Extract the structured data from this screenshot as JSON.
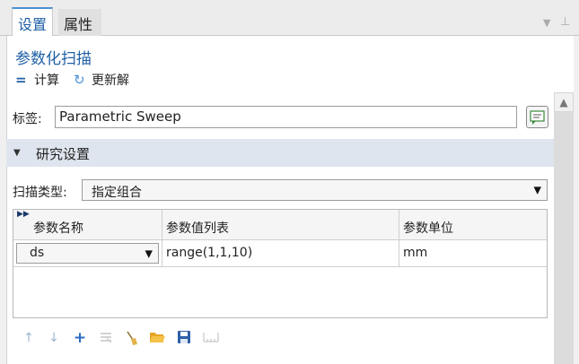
{
  "tabs": [
    {
      "label": "设置",
      "active": true
    },
    {
      "label": "属性",
      "active": false
    }
  ],
  "window_controls": {
    "menu_icon": "triangle-down-icon",
    "pin_icon": "pin-icon"
  },
  "panel": {
    "title": "参数化扫描",
    "compute_label": "计算",
    "update_label": "更新解"
  },
  "label_field": {
    "label": "标签:",
    "value": "Parametric Sweep"
  },
  "section": {
    "title": "研究设置"
  },
  "sweep_type": {
    "label": "扫描类型:",
    "value": "指定组合"
  },
  "table": {
    "headers": [
      "参数名称",
      "参数值列表",
      "参数单位"
    ],
    "rows": [
      {
        "name": "ds",
        "values": "range(1,1,10)",
        "unit": "mm"
      }
    ]
  },
  "table_toolbar": [
    "arrow-up-icon",
    "arrow-down-icon",
    "add-icon",
    "delete-list-icon",
    "clear-broom-icon",
    "open-folder-icon",
    "save-icon",
    "range-icon"
  ],
  "colors": {
    "accent": "#1f5fa6",
    "section_bg": "#dfe5ee"
  }
}
